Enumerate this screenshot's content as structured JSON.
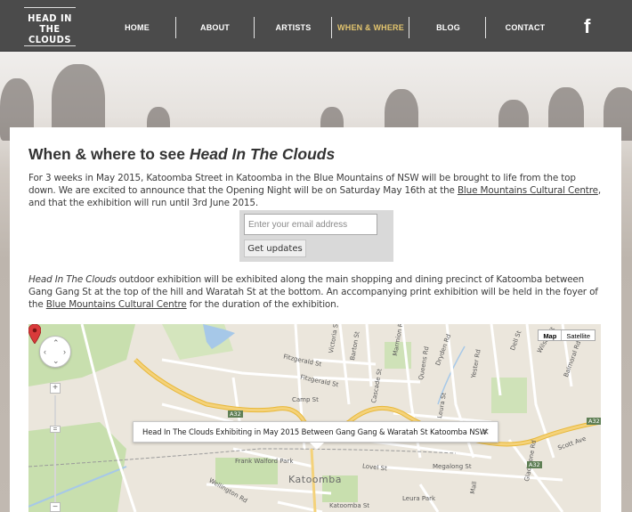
{
  "nav": {
    "logo_line1": "HEAD IN",
    "logo_line2": "THE CLOUDS",
    "items": [
      {
        "label": "HOME"
      },
      {
        "label": "ABOUT"
      },
      {
        "label": "ARTISTS"
      },
      {
        "label": "WHEN & WHERE",
        "active": true
      },
      {
        "label": "BLOG"
      },
      {
        "label": "CONTACT"
      }
    ],
    "facebook_glyph": "f",
    "active_color": "#e2c46e"
  },
  "main": {
    "title_plain": "When & where to see ",
    "title_italic": "Head In The Clouds",
    "p1_text_a": "For 3 weeks in May 2015, Katoomba Street in Katoomba in the Blue Mountains of NSW will be brought to life from the top down. We are excited to announce that the Opening Night will be on Saturday May 16th at the ",
    "p1_link": "Blue Mountains Cultural Centre",
    "p1_text_b": ", and that the exhibition will run until 3rd June 2015.",
    "email_placeholder": "Enter your email address",
    "updates_button": "Get updates",
    "p2_italic": "Head In The Clouds",
    "p2_text_a": " outdoor exhibition will be exhibited along the main shopping and dining precinct of Katoomba between Gang Gang St at the top of the hill and Waratah St at the bottom. An accompanying print exhibition will be held in the foyer of the ",
    "p2_link": "Blue Mountains Cultural Centre",
    "p2_text_b": " for the duration of the exhibition."
  },
  "map": {
    "type_map": "Map",
    "type_satellite": "Satellite",
    "zoom_in": "+",
    "zoom_out": "−",
    "zoom_knob": "=",
    "info_text": "Head In The Clouds Exhibiting in May 2015 Between Gang Gang & Waratah St Katoomba NSW",
    "info_close": "×",
    "town": "Katoomba",
    "park": "Frank Walford Park",
    "streets": {
      "victoria": "Victoria St",
      "barton": "Barton St",
      "fitzgerald1": "Fitzgerald St",
      "fitzgerald2": "Fitzgerald St",
      "camp": "Camp St",
      "cascade": "Cascade St",
      "lovel": "Lovel St",
      "megalong": "Megalong St",
      "scott": "Scott Ave",
      "wellington": "Wellington Rd",
      "leura": "Leura Park",
      "gladstone": "Gladstone Rd",
      "mall": "Mall",
      "marmion": "Marmion Rd",
      "queens": "Queens Rd",
      "dryden": "Dryden Rd",
      "yester": "Yester Rd",
      "dell": "Dell St",
      "wilson": "Wilson St",
      "balmoral": "Balmoral Rd",
      "leura_st": "Leura St",
      "katoomba_st": "Katoomba St"
    },
    "road_shield1": "A32",
    "road_shield2": "A32",
    "road_shield3": "A32",
    "colors": {
      "land": "#ebe6dc",
      "park": "#c8dfae",
      "water": "#a6c8e8",
      "highway": "#f4d27a",
      "pin": "#d93a3a"
    }
  }
}
